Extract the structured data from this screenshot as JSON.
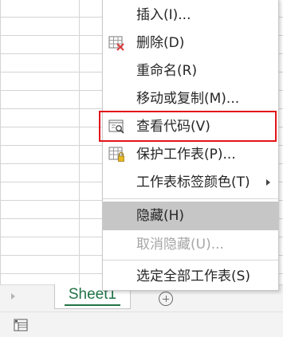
{
  "sheet_tabs": {
    "active_tab_label": "Sheet1",
    "accent_color": "#217346"
  },
  "context_menu": {
    "items": [
      {
        "label": "插入(I)...",
        "icon": "none",
        "state": "normal"
      },
      {
        "label": "删除(D)",
        "icon": "delete-sheet-icon",
        "state": "normal"
      },
      {
        "label": "重命名(R)",
        "icon": "none",
        "state": "normal"
      },
      {
        "label": "移动或复制(M)...",
        "icon": "none",
        "state": "normal"
      },
      {
        "label": "查看代码(V)",
        "icon": "view-code-icon",
        "state": "normal"
      },
      {
        "label": "保护工作表(P)...",
        "icon": "protect-sheet-icon",
        "state": "normal"
      },
      {
        "label": "工作表标签颜色(T)",
        "icon": "none",
        "state": "submenu"
      },
      {
        "label": "隐藏(H)",
        "icon": "none",
        "state": "highlighted"
      },
      {
        "label": "取消隐藏(U)...",
        "icon": "none",
        "state": "disabled"
      },
      {
        "label": "选定全部工作表(S)",
        "icon": "none",
        "state": "normal"
      }
    ],
    "annotation_color": "#e2141b"
  }
}
